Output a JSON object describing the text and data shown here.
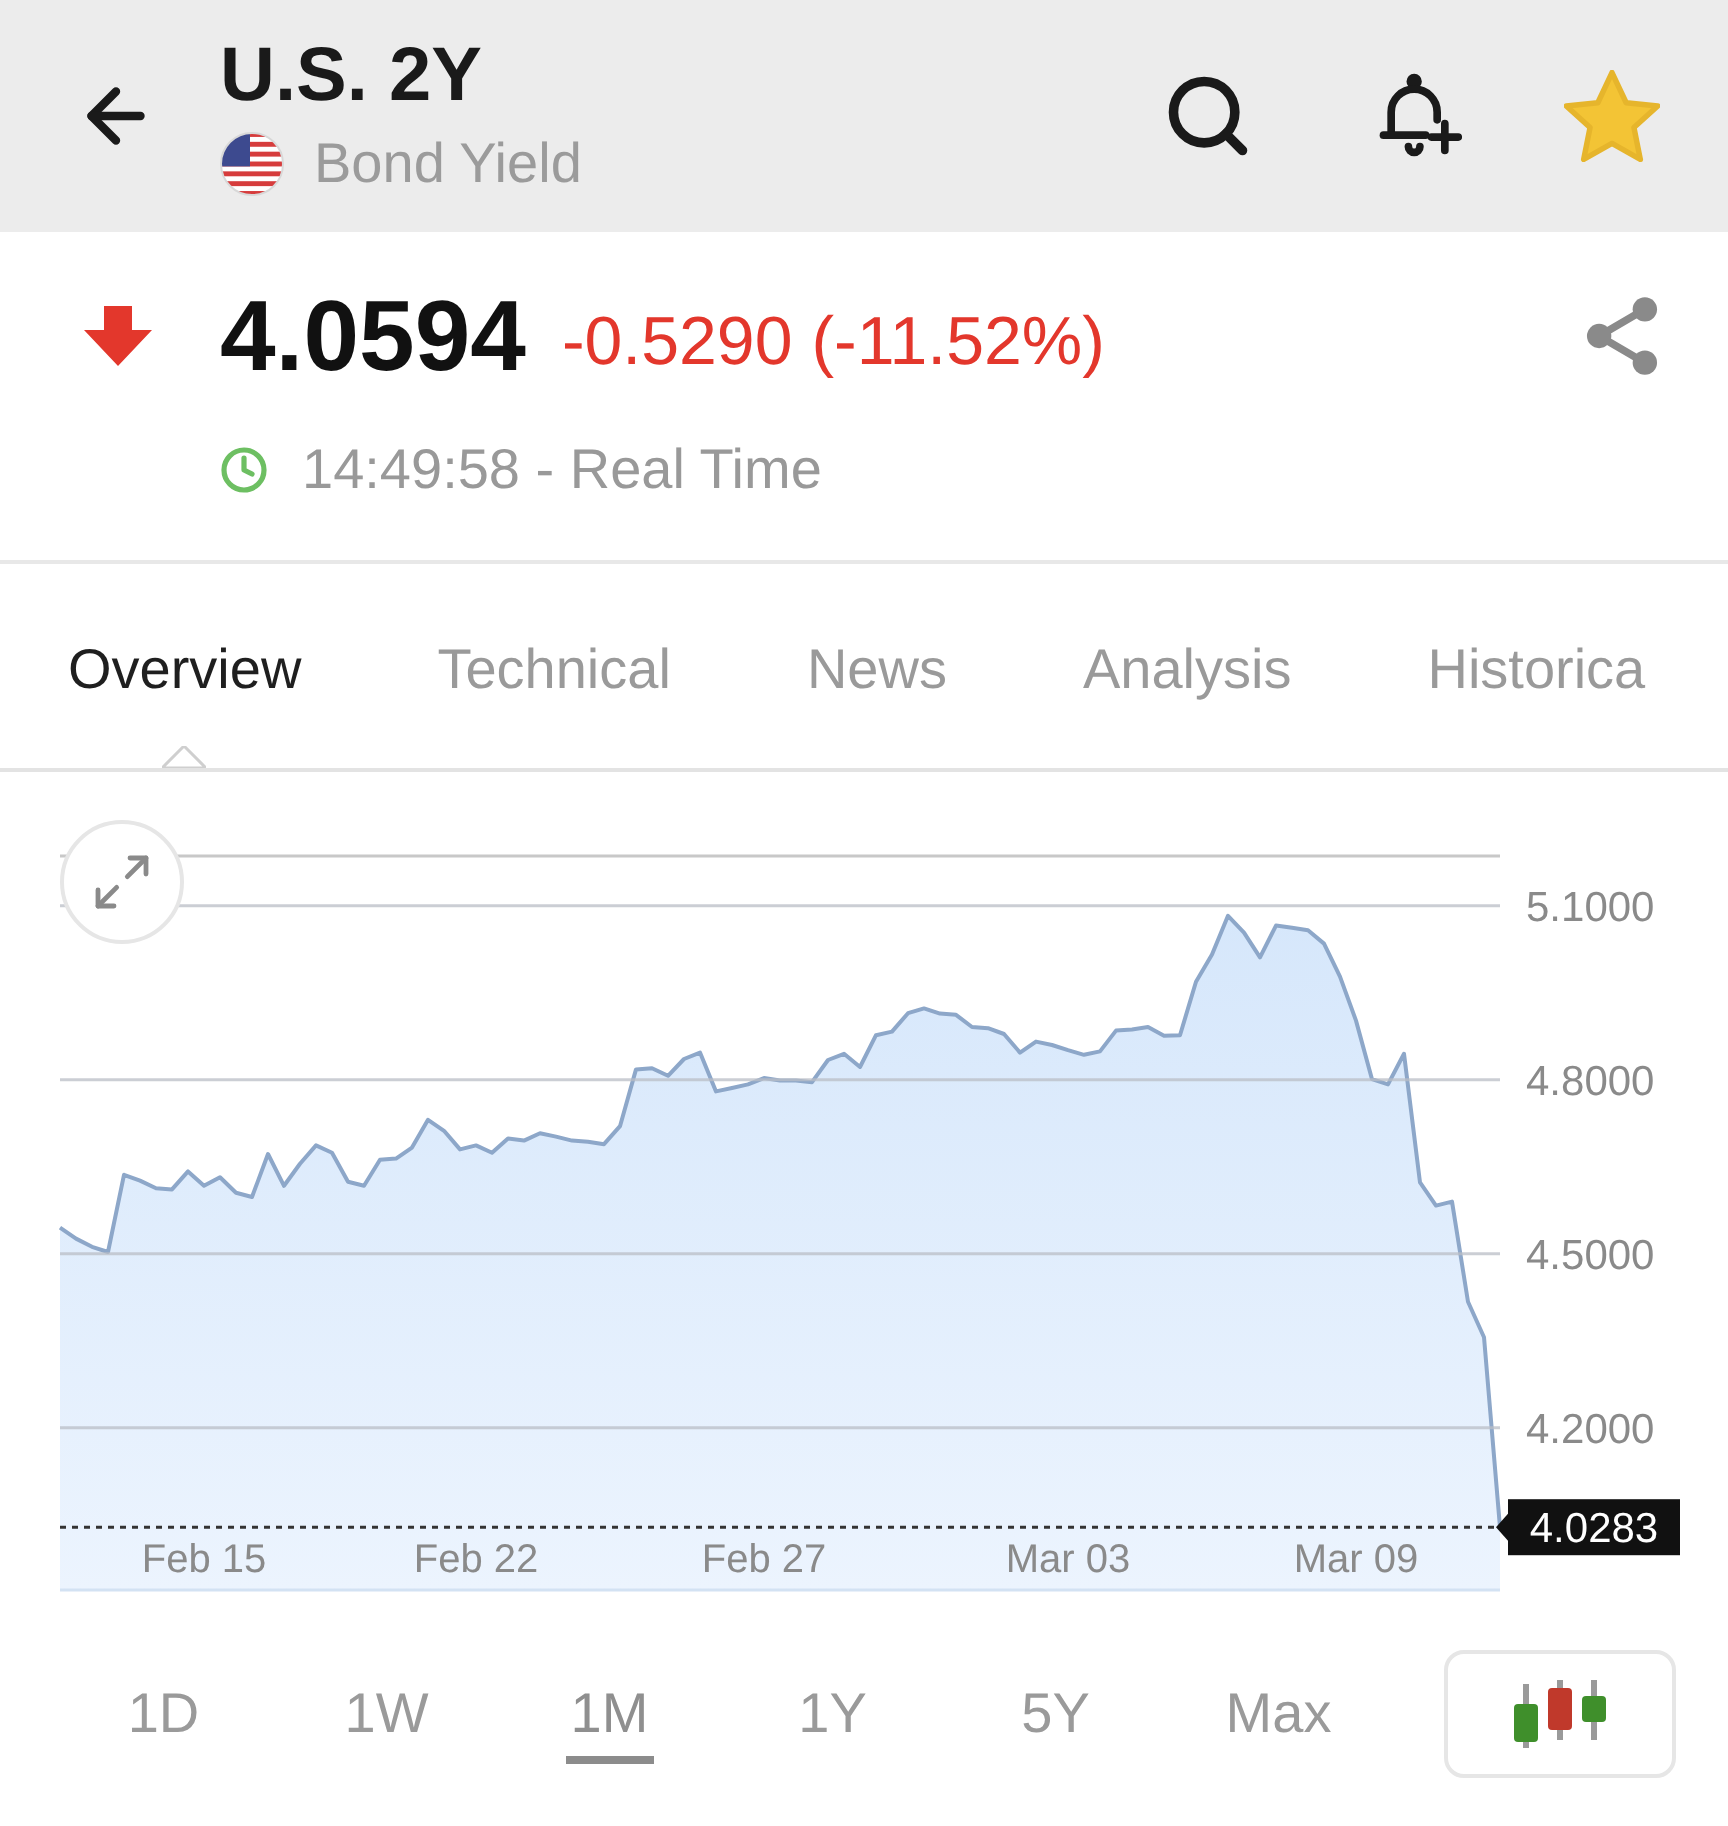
{
  "header": {
    "title": "U.S. 2Y",
    "subtitle": "Bond Yield",
    "favorite": true
  },
  "quote": {
    "price": "4.0594",
    "change": "-0.5290 (-11.52%)",
    "down": true,
    "time": "14:49:58 - Real Time"
  },
  "tabs": [
    {
      "label": "Overview",
      "selected": true
    },
    {
      "label": "Technical",
      "selected": false
    },
    {
      "label": "News",
      "selected": false
    },
    {
      "label": "Analysis",
      "selected": false
    },
    {
      "label": "Historica",
      "selected": false
    }
  ],
  "chart": {
    "chart_data": {
      "type": "area",
      "grid": true,
      "categories": [
        null,
        null,
        null,
        null,
        null,
        null,
        null,
        null,
        null,
        "Feb 15",
        null,
        null,
        null,
        null,
        null,
        null,
        null,
        null,
        null,
        null,
        null,
        null,
        null,
        null,
        null,
        null,
        "Feb 22",
        null,
        null,
        null,
        null,
        null,
        null,
        null,
        null,
        null,
        null,
        null,
        null,
        null,
        null,
        null,
        null,
        null,
        "Feb 27",
        null,
        null,
        null,
        null,
        null,
        null,
        null,
        null,
        null,
        null,
        null,
        null,
        null,
        null,
        null,
        null,
        null,
        null,
        "Mar 03",
        null,
        null,
        null,
        null,
        null,
        null,
        null,
        null,
        null,
        null,
        null,
        null,
        null,
        null,
        null,
        null,
        null,
        "Mar 09",
        null,
        null,
        null,
        null,
        null,
        null,
        null,
        null,
        null
      ],
      "ylim": [
        3.92,
        5.186
      ],
      "yticks": [
        {
          "value": 4.2,
          "label": "4.2000"
        },
        {
          "value": 4.5,
          "label": "4.5000"
        },
        {
          "value": 4.8,
          "label": "4.8000"
        },
        {
          "value": 5.1,
          "label": "5.1000"
        }
      ],
      "values": [
        4.545,
        4.526,
        4.512,
        4.503,
        4.636,
        4.626,
        4.613,
        4.611,
        4.642,
        4.617,
        4.632,
        4.605,
        4.598,
        4.672,
        4.617,
        4.655,
        4.687,
        4.674,
        4.624,
        4.617,
        4.662,
        4.664,
        4.683,
        4.731,
        4.712,
        4.68,
        4.687,
        4.674,
        4.699,
        4.695,
        4.708,
        4.702,
        4.695,
        4.693,
        4.689,
        4.72,
        4.818,
        4.82,
        4.807,
        4.836,
        4.847,
        4.78,
        4.786,
        4.792,
        4.803,
        4.799,
        4.799,
        4.796,
        4.834,
        4.845,
        4.822,
        4.877,
        4.883,
        4.915,
        4.923,
        4.914,
        4.912,
        4.891,
        4.889,
        4.879,
        4.847,
        4.866,
        4.86,
        4.851,
        4.843,
        4.849,
        4.885,
        4.887,
        4.891,
        4.876,
        4.877,
        4.969,
        5.016,
        5.083,
        5.054,
        5.011,
        5.066,
        5.062,
        5.058,
        5.035,
        4.978,
        4.902,
        4.801,
        4.792,
        4.845,
        4.623,
        4.583,
        4.59,
        4.417,
        4.356,
        4.028
      ],
      "ref_lines": [
        {
          "axis": "y",
          "value": 4.0283,
          "label": "4.0283"
        }
      ]
    }
  },
  "periods": [
    {
      "label": "1D",
      "selected": false
    },
    {
      "label": "1W",
      "selected": false
    },
    {
      "label": "1M",
      "selected": true
    },
    {
      "label": "1Y",
      "selected": false
    },
    {
      "label": "5Y",
      "selected": false
    },
    {
      "label": "Max",
      "selected": false
    }
  ]
}
